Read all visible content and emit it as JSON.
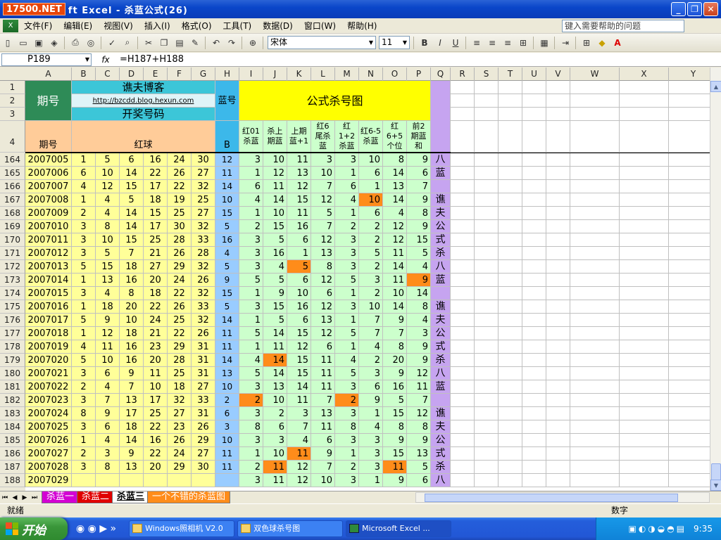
{
  "window": {
    "logo": "17500.NET",
    "title": "ft Excel - 杀蓝公式(26)",
    "min": "_",
    "max": "❐",
    "close": "✕"
  },
  "menu": {
    "items": [
      "文件(F)",
      "编辑(E)",
      "视图(V)",
      "插入(I)",
      "格式(O)",
      "工具(T)",
      "数据(D)",
      "窗口(W)",
      "帮助(H)"
    ],
    "help_placeholder": "键入需要帮助的问题"
  },
  "toolbar": {
    "font_name": "宋体",
    "font_size": "11",
    "bold": "B",
    "italic": "I",
    "underline": "U"
  },
  "formula": {
    "cell_ref": "P189",
    "fx": "fx",
    "content": "=H187+H188"
  },
  "columns": [
    "A",
    "B",
    "C",
    "D",
    "E",
    "F",
    "G",
    "H",
    "I",
    "J",
    "K",
    "L",
    "M",
    "N",
    "O",
    "P",
    "Q",
    "R",
    "S",
    "T",
    "U",
    "V",
    "W",
    "X",
    "Y"
  ],
  "header": {
    "period_label": "期号",
    "blog_title": "谯夫博客",
    "blog_url": "http://bzcdd.blog.hexun.com",
    "draw_title": "开奖号码",
    "blue_no": "蓝号",
    "formula_title": "公式杀号图",
    "period_small": "期号",
    "red_ball": "红球",
    "b_col": "B",
    "formula_cols": [
      "红01\n杀蓝",
      "杀上\n期蓝",
      "上期\n蓝+1",
      "红6\n尾杀\n蓝",
      "红\n1+2\n杀蓝",
      "红6-5\n杀蓝",
      "红\n6+5\n个位",
      "前2\n期蓝\n和"
    ]
  },
  "rows": [
    {
      "n": "164",
      "p": "2007005",
      "r": [
        1,
        5,
        6,
        16,
        24,
        30
      ],
      "b": 12,
      "f": [
        3,
        10,
        11,
        3,
        3,
        10,
        8,
        9
      ]
    },
    {
      "n": "165",
      "p": "2007006",
      "r": [
        6,
        10,
        14,
        22,
        26,
        27
      ],
      "b": 11,
      "f": [
        1,
        12,
        13,
        10,
        1,
        6,
        14,
        6
      ]
    },
    {
      "n": "166",
      "p": "2007007",
      "r": [
        4,
        12,
        15,
        17,
        22,
        32
      ],
      "b": 14,
      "f": [
        6,
        11,
        12,
        7,
        6,
        1,
        13,
        7
      ]
    },
    {
      "n": "167",
      "p": "2007008",
      "r": [
        1,
        4,
        5,
        18,
        19,
        25
      ],
      "b": 10,
      "f": [
        4,
        14,
        15,
        12,
        4,
        10,
        14,
        9
      ]
    },
    {
      "n": "168",
      "p": "2007009",
      "r": [
        2,
        4,
        14,
        15,
        25,
        27
      ],
      "b": 15,
      "f": [
        1,
        10,
        11,
        5,
        1,
        6,
        4,
        8
      ]
    },
    {
      "n": "169",
      "p": "2007010",
      "r": [
        3,
        8,
        14,
        17,
        30,
        32
      ],
      "b": 5,
      "f": [
        2,
        15,
        16,
        7,
        2,
        2,
        12,
        9
      ]
    },
    {
      "n": "170",
      "p": "2007011",
      "r": [
        3,
        10,
        15,
        25,
        28,
        33
      ],
      "b": 16,
      "f": [
        3,
        5,
        6,
        12,
        3,
        2,
        12,
        15
      ]
    },
    {
      "n": "171",
      "p": "2007012",
      "r": [
        3,
        5,
        7,
        21,
        26,
        28
      ],
      "b": 4,
      "f": [
        3,
        16,
        1,
        13,
        3,
        5,
        11,
        5
      ]
    },
    {
      "n": "172",
      "p": "2007013",
      "r": [
        5,
        15,
        18,
        27,
        29,
        32
      ],
      "b": 5,
      "f": [
        3,
        4,
        5,
        8,
        3,
        2,
        14,
        4
      ]
    },
    {
      "n": "173",
      "p": "2007014",
      "r": [
        1,
        13,
        16,
        20,
        24,
        26
      ],
      "b": 9,
      "f": [
        5,
        5,
        6,
        12,
        5,
        3,
        11,
        9
      ]
    },
    {
      "n": "174",
      "p": "2007015",
      "r": [
        3,
        4,
        8,
        18,
        22,
        32
      ],
      "b": 15,
      "f": [
        1,
        9,
        10,
        6,
        1,
        2,
        10,
        14
      ]
    },
    {
      "n": "175",
      "p": "2007016",
      "r": [
        1,
        18,
        20,
        22,
        26,
        33
      ],
      "b": 5,
      "f": [
        3,
        15,
        16,
        12,
        3,
        10,
        14,
        8
      ]
    },
    {
      "n": "176",
      "p": "2007017",
      "r": [
        5,
        9,
        10,
        24,
        25,
        32
      ],
      "b": 14,
      "f": [
        1,
        5,
        6,
        13,
        1,
        7,
        9,
        4
      ]
    },
    {
      "n": "177",
      "p": "2007018",
      "r": [
        1,
        12,
        18,
        21,
        22,
        26
      ],
      "b": 11,
      "f": [
        5,
        14,
        15,
        12,
        5,
        7,
        7,
        3
      ]
    },
    {
      "n": "178",
      "p": "2007019",
      "r": [
        4,
        11,
        16,
        23,
        29,
        31
      ],
      "b": 11,
      "f": [
        1,
        11,
        12,
        6,
        1,
        4,
        8,
        9
      ]
    },
    {
      "n": "179",
      "p": "2007020",
      "r": [
        5,
        10,
        16,
        20,
        28,
        31
      ],
      "b": 14,
      "f": [
        4,
        14,
        15,
        11,
        4,
        2,
        20,
        9
      ]
    },
    {
      "n": "180",
      "p": "2007021",
      "r": [
        3,
        6,
        9,
        11,
        25,
        31
      ],
      "b": 13,
      "f": [
        5,
        14,
        15,
        11,
        5,
        3,
        9,
        12
      ]
    },
    {
      "n": "181",
      "p": "2007022",
      "r": [
        2,
        4,
        7,
        10,
        18,
        27
      ],
      "b": 10,
      "f": [
        3,
        13,
        14,
        11,
        3,
        6,
        16,
        11
      ]
    },
    {
      "n": "182",
      "p": "2007023",
      "r": [
        3,
        7,
        13,
        17,
        32,
        33
      ],
      "b": 2,
      "f": [
        2,
        10,
        11,
        7,
        2,
        9,
        5,
        7
      ]
    },
    {
      "n": "183",
      "p": "2007024",
      "r": [
        8,
        9,
        17,
        25,
        27,
        31
      ],
      "b": 6,
      "f": [
        3,
        2,
        3,
        13,
        3,
        1,
        15,
        12
      ]
    },
    {
      "n": "184",
      "p": "2007025",
      "r": [
        3,
        6,
        18,
        22,
        23,
        26
      ],
      "b": 3,
      "f": [
        8,
        6,
        7,
        11,
        8,
        4,
        8,
        8
      ]
    },
    {
      "n": "185",
      "p": "2007026",
      "r": [
        1,
        4,
        14,
        16,
        26,
        29
      ],
      "b": 10,
      "f": [
        3,
        3,
        4,
        6,
        3,
        3,
        9,
        9
      ]
    },
    {
      "n": "186",
      "p": "2007027",
      "r": [
        2,
        3,
        9,
        22,
        24,
        27
      ],
      "b": 11,
      "f": [
        1,
        10,
        11,
        9,
        1,
        3,
        15,
        13
      ]
    },
    {
      "n": "187",
      "p": "2007028",
      "r": [
        3,
        8,
        13,
        20,
        29,
        30
      ],
      "b": 11,
      "f": [
        2,
        11,
        12,
        7,
        2,
        3,
        11,
        5
      ]
    },
    {
      "n": "188",
      "p": "2007029",
      "r": [],
      "b": "",
      "f": [
        3,
        11,
        12,
        10,
        3,
        1,
        9,
        6
      ]
    }
  ],
  "highlights": [
    [
      3,
      5
    ],
    [
      8,
      2
    ],
    [
      9,
      7
    ],
    [
      15,
      1
    ],
    [
      18,
      0
    ],
    [
      18,
      4
    ],
    [
      22,
      2
    ],
    [
      23,
      1
    ],
    [
      23,
      6
    ]
  ],
  "side_text": [
    "八",
    "蓝",
    "",
    "谯",
    "夫",
    "公",
    "式",
    "杀",
    "八",
    "蓝",
    "",
    "谯",
    "夫",
    "公",
    "式",
    "杀",
    "八",
    "蓝",
    "",
    "谯",
    "夫",
    "公",
    "式",
    "杀",
    "八"
  ],
  "tabs": [
    "杀蓝一",
    "杀蓝二",
    "杀蓝三",
    "一个不错的杀蓝图"
  ],
  "status": {
    "ready": "就绪",
    "mode": "数字"
  },
  "taskbar": {
    "start": "开始",
    "items": [
      "Windows照相机 V2.0",
      "双色球杀号图",
      "Microsoft Excel ..."
    ],
    "time": "9:35"
  }
}
